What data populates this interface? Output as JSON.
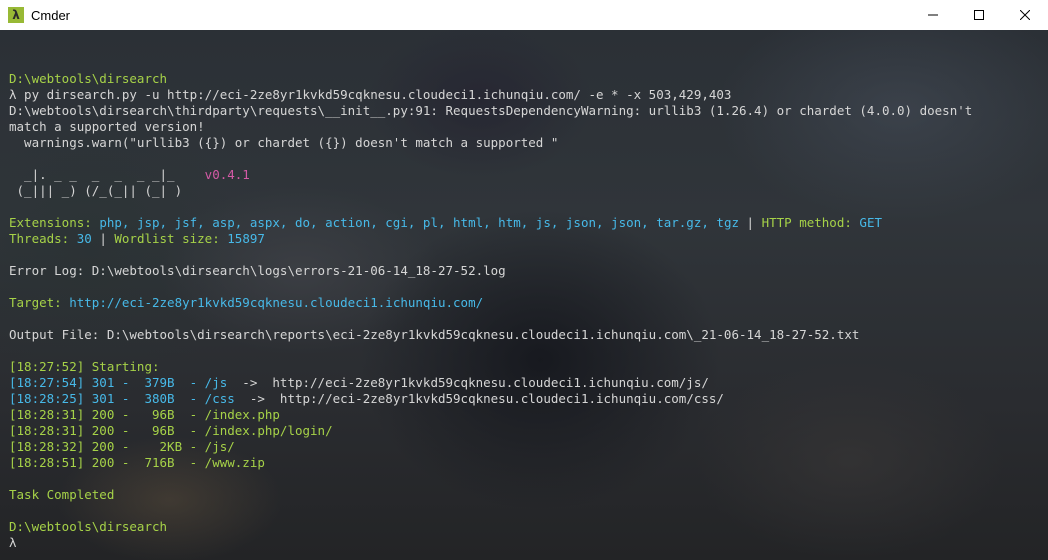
{
  "window": {
    "title": "Cmder",
    "app_icon": "λ"
  },
  "colors": {
    "green": "#a6d248",
    "blue": "#47b9e8",
    "white": "#d6d6d6"
  },
  "terminal": {
    "lines": [
      "",
      [
        [
          "D:\\webtools\\dirsearch",
          "green"
        ]
      ],
      [
        [
          "λ py dirsearch.py -u http://eci-2ze8yr1kvkd59cqknesu.cloudeci1.ichunqiu.com/ -e * -x 503,429,403",
          "white"
        ]
      ],
      [
        [
          "D:\\webtools\\dirsearch\\thirdparty\\requests\\__init__.py:91: RequestsDependencyWarning: urllib3 (1.26.4) or chardet (4.0.0) doesn't",
          "white"
        ]
      ],
      [
        [
          "match a supported version!",
          "white"
        ]
      ],
      [
        [
          "  warnings.warn(\"urllib3 ({}) or chardet ({}) doesn't match a supported \"",
          "white"
        ]
      ],
      "",
      [
        [
          "  _|. _ _  _  _  _ _|_    ",
          "logo"
        ],
        [
          "v0.4.1",
          "ver"
        ]
      ],
      [
        [
          " (_||| _) (/_(_|| (_| )",
          "logo"
        ]
      ],
      "",
      [
        [
          "Extensions: ",
          "green"
        ],
        [
          "php, jsp, jsf, asp, aspx, do, action, cgi, pl, html, htm, js, json, json, tar.gz, tgz",
          "blue"
        ],
        [
          " | ",
          "white"
        ],
        [
          "HTTP method: ",
          "green"
        ],
        [
          "GET",
          "blue"
        ]
      ],
      [
        [
          "Threads: ",
          "green"
        ],
        [
          "30",
          "blue"
        ],
        [
          " | ",
          "white"
        ],
        [
          "Wordlist size: ",
          "green"
        ],
        [
          "15897",
          "blue"
        ]
      ],
      "",
      [
        [
          "Error Log: D:\\webtools\\dirsearch\\logs\\errors-21-06-14_18-27-52.log",
          "white"
        ]
      ],
      "",
      [
        [
          "Target: ",
          "green"
        ],
        [
          "http://eci-2ze8yr1kvkd59cqknesu.cloudeci1.ichunqiu.com/",
          "blue"
        ]
      ],
      "",
      [
        [
          "Output File: D:\\webtools\\dirsearch\\reports\\eci-2ze8yr1kvkd59cqknesu.cloudeci1.ichunqiu.com\\_21-06-14_18-27-52.txt",
          "white"
        ]
      ],
      "",
      [
        [
          "[18:27:52] Starting: ",
          "green"
        ]
      ],
      [
        [
          "[18:27:54] 301 -  379B  - /js  ",
          "blue"
        ],
        [
          "->  http://eci-2ze8yr1kvkd59cqknesu.cloudeci1.ichunqiu.com/js/",
          "white"
        ]
      ],
      [
        [
          "[18:28:25] 301 -  380B  - /css  ",
          "blue"
        ],
        [
          "->  http://eci-2ze8yr1kvkd59cqknesu.cloudeci1.ichunqiu.com/css/",
          "white"
        ]
      ],
      [
        [
          "[18:28:31] 200 -   96B  - /index.php",
          "green"
        ]
      ],
      [
        [
          "[18:28:31] 200 -   96B  - /index.php/login/",
          "green"
        ]
      ],
      [
        [
          "[18:28:32] 200 -    2KB - /js/",
          "green"
        ]
      ],
      [
        [
          "[18:28:51] 200 -  716B  - /www.zip",
          "green"
        ]
      ],
      "",
      [
        [
          "Task Completed",
          "green"
        ]
      ],
      "",
      [
        [
          "D:\\webtools\\dirsearch",
          "green"
        ]
      ],
      [
        [
          "λ",
          "white"
        ]
      ]
    ]
  }
}
